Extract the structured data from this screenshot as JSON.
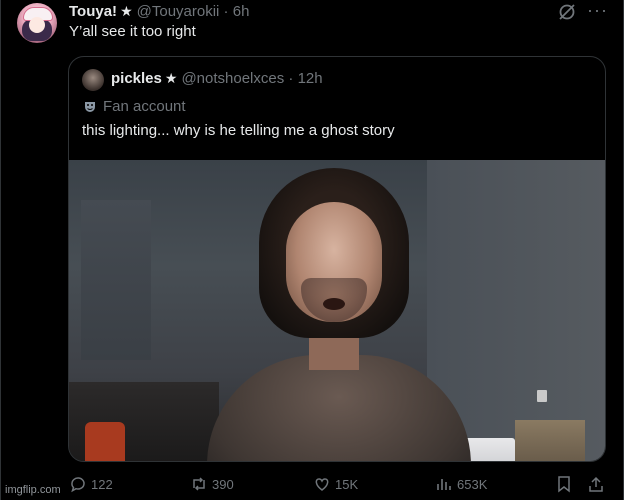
{
  "tweet": {
    "display_name": "Touya!",
    "handle": "@Touyarokii",
    "time": "6h",
    "text": "Y’all see it too right"
  },
  "quoted": {
    "display_name": "pickles",
    "handle": "@notshoelxces",
    "time": "12h",
    "label": "Fan account",
    "text": "this lighting... why is he telling me a ghost story"
  },
  "actions": {
    "replies": "122",
    "reposts": "390",
    "likes": "15K",
    "views": "653K"
  },
  "watermark": "imgflip.com",
  "icons": [
    "grok-icon",
    "more-icon",
    "reply-icon",
    "repost-icon",
    "like-icon",
    "views-icon",
    "bookmark-icon",
    "share-icon",
    "theater-mask-icon",
    "star-icon"
  ],
  "colors": {
    "background": "#000000",
    "text": "#e7e9ea",
    "muted": "#71767b",
    "border": "#2f3336"
  }
}
